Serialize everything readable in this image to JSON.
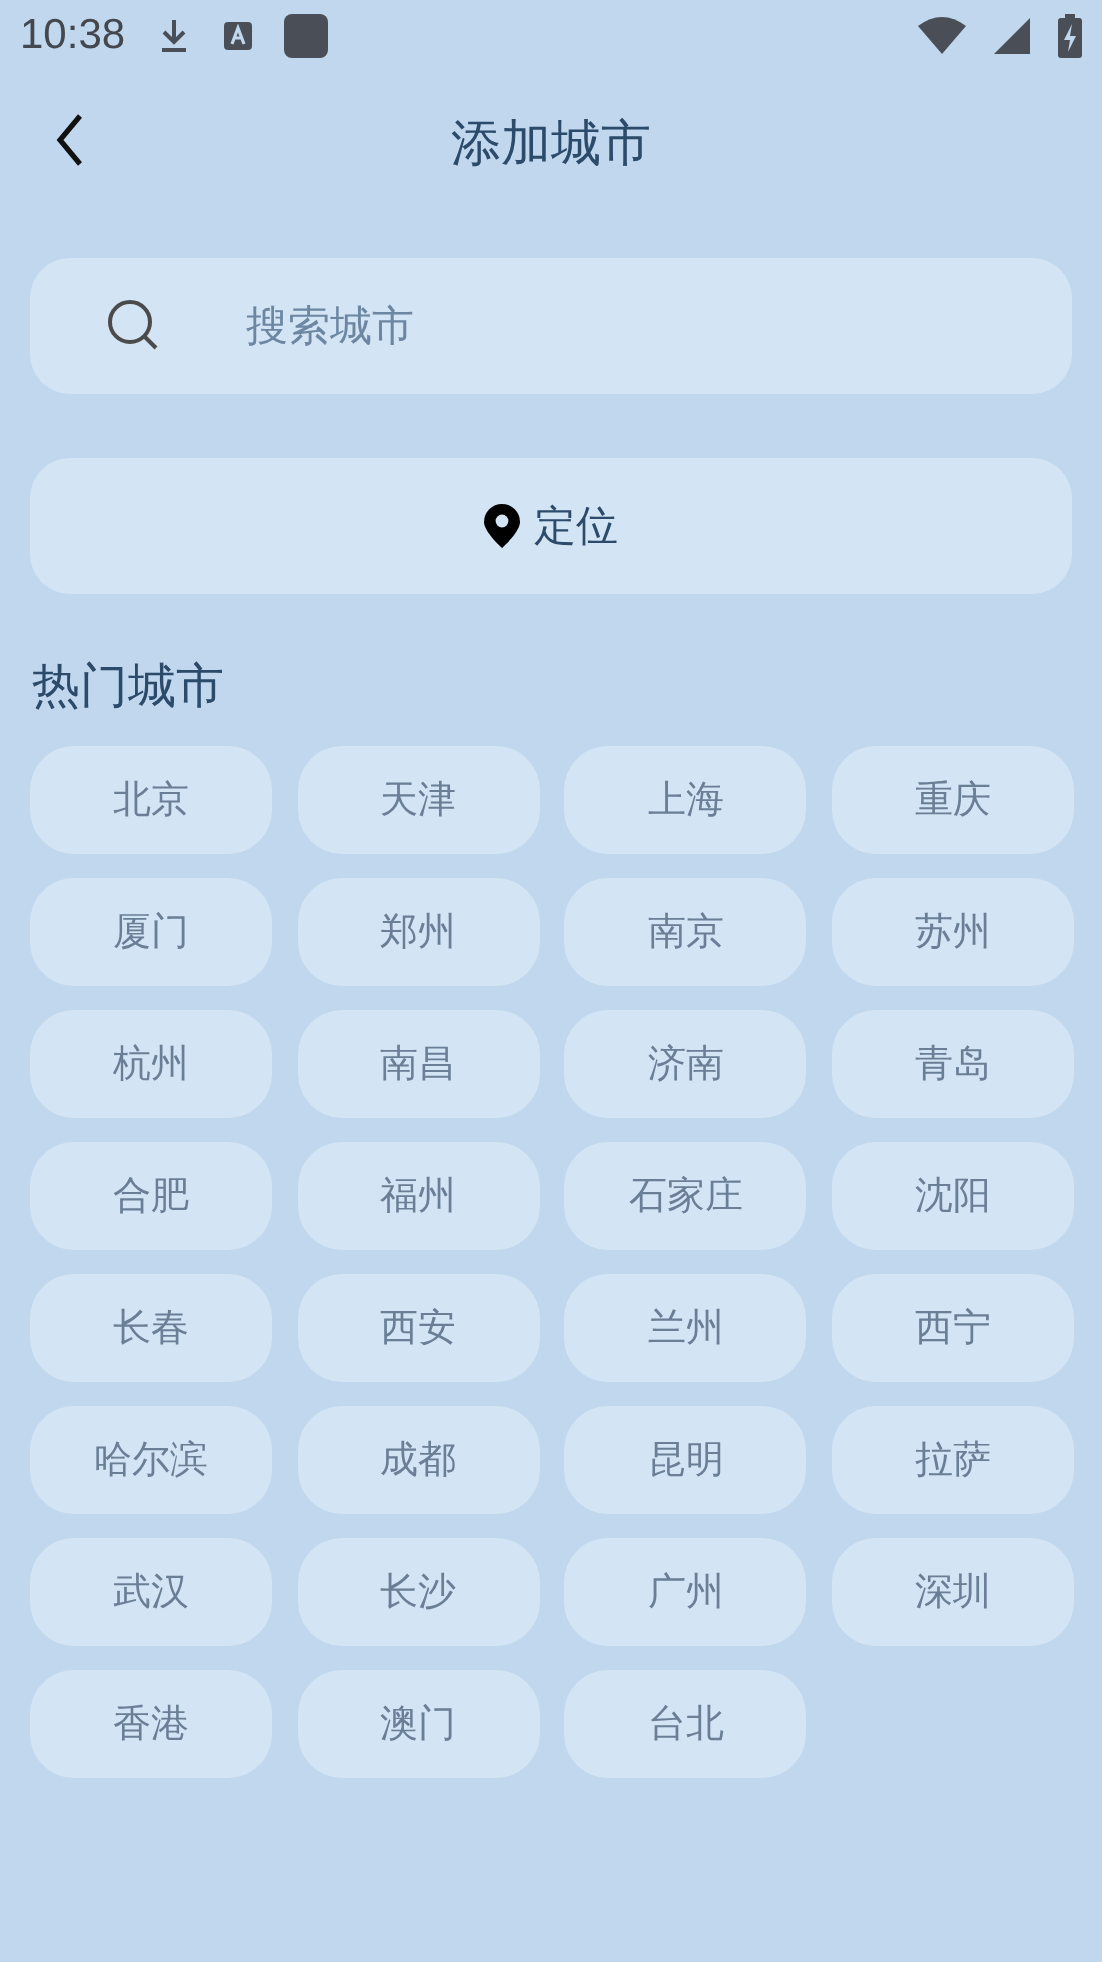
{
  "status_bar": {
    "time": "10:38"
  },
  "header": {
    "title": "添加城市"
  },
  "search": {
    "placeholder": "搜索城市"
  },
  "locate_button": {
    "label": "定位"
  },
  "hot_cities": {
    "title": "热门城市",
    "items": [
      "北京",
      "天津",
      "上海",
      "重庆",
      "厦门",
      "郑州",
      "南京",
      "苏州",
      "杭州",
      "南昌",
      "济南",
      "青岛",
      "合肥",
      "福州",
      "石家庄",
      "沈阳",
      "长春",
      "西安",
      "兰州",
      "西宁",
      "哈尔滨",
      "成都",
      "昆明",
      "拉萨",
      "武汉",
      "长沙",
      "广州",
      "深圳",
      "香港",
      "澳门",
      "台北"
    ]
  }
}
